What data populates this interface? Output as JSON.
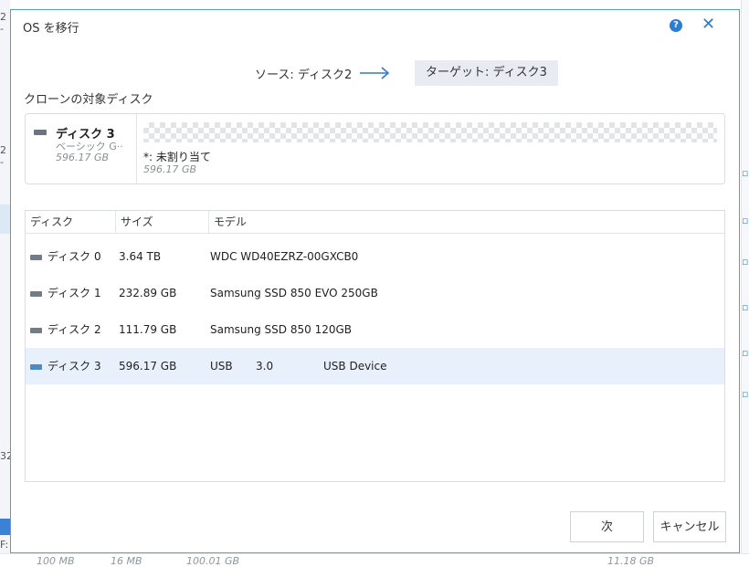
{
  "dialog": {
    "title": "OS を移行",
    "help_icon": "?",
    "close_icon": "✕"
  },
  "migration": {
    "source_label": "ソース: ディスク2",
    "target_label": "ターゲット: ディスク3"
  },
  "target_section": {
    "label": "クローンの対象ディスク",
    "disk_name": "ディスク 3",
    "disk_type": "ベーシック G··",
    "disk_size": "596.17 GB",
    "partition_label": "*: 未割り当て",
    "partition_size": "596.17 GB"
  },
  "table": {
    "headers": [
      "ディスク",
      "サイズ",
      "モデル"
    ],
    "rows": [
      {
        "disk": "ディスク 0",
        "size": "3.64 TB",
        "model": "WDC WD40EZRZ-00GXCB0",
        "model2": "",
        "model3": ""
      },
      {
        "disk": "ディスク 1",
        "size": "232.89 GB",
        "model": "Samsung SSD 850 EVO 250GB",
        "model2": "",
        "model3": ""
      },
      {
        "disk": "ディスク 2",
        "size": "111.79 GB",
        "model": "Samsung SSD 850 120GB",
        "model2": "",
        "model3": ""
      },
      {
        "disk": "ディスク 3",
        "size": "596.17 GB",
        "model": "USB",
        "model2": "3.0",
        "model3": "USB Device",
        "selected": true
      }
    ]
  },
  "buttons": {
    "next": "次",
    "cancel": "キャンセル"
  },
  "background": {
    "left_fragments": [
      "2 -",
      "2 -",
      "32",
      "F:"
    ],
    "bottom_values": [
      "100 MB",
      "16 MB",
      "100.01 GB",
      "11.18 GB"
    ]
  },
  "colors": {
    "accent": "#2b7cd3",
    "selected_row": "#e8f1fb",
    "target_badge": "#e9ebf2"
  }
}
